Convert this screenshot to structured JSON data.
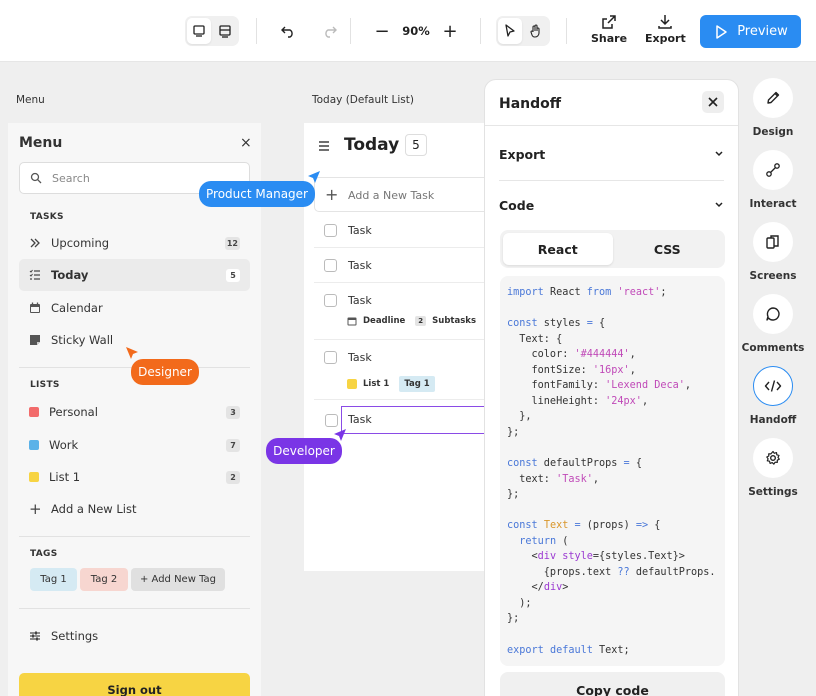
{
  "toolbar": {
    "zoom": "90%",
    "share_label": "Share",
    "export_label": "Export",
    "preview_label": "Preview"
  },
  "labels": {
    "menu_section": "Menu",
    "today_section": "Today (Default List)"
  },
  "menu": {
    "title": "Menu",
    "close": "×",
    "search_placeholder": "Search",
    "tasks_title": "TASKS",
    "tasks": [
      {
        "label": "Upcoming",
        "count": "12",
        "icon": "chevrons-right-icon"
      },
      {
        "label": "Today",
        "count": "5",
        "icon": "list-check-icon"
      },
      {
        "label": "Calendar",
        "icon": "calendar-icon"
      },
      {
        "label": "Sticky Wall",
        "icon": "sticky-note-icon"
      }
    ],
    "lists_title": "LISTS",
    "lists": [
      {
        "label": "Personal",
        "count": "3",
        "color": "#f26b6b"
      },
      {
        "label": "Work",
        "count": "7",
        "color": "#5bb2e8"
      },
      {
        "label": "List 1",
        "count": "2",
        "color": "#f7d443"
      }
    ],
    "add_list": "Add a New List",
    "tags_title": "TAGS",
    "tags": [
      {
        "label": "Tag 1",
        "color": "#d5eaf3"
      },
      {
        "label": "Tag 2",
        "color": "#f7d6d0"
      },
      {
        "label": "+ Add New Tag",
        "color": "#e4e4e4"
      }
    ],
    "settings": "Settings",
    "signout": "Sign out"
  },
  "today": {
    "title": "Today",
    "count": "5",
    "add_task": "Add a New Task",
    "tasks": [
      {
        "label": "Task"
      },
      {
        "label": "Task"
      },
      {
        "label": "Task",
        "deadline": "Deadline",
        "subtasks_count": "2",
        "subtasks_label": "Subtasks"
      },
      {
        "label": "Task",
        "list": "List 1",
        "tag": "Tag 1"
      },
      {
        "label": "Task"
      }
    ]
  },
  "handoff": {
    "title": "Handoff",
    "export_label": "Export",
    "code_label": "Code",
    "tabs": [
      "React",
      "CSS"
    ],
    "active_tab": "React",
    "copy_label": "Copy code",
    "code_lines": [
      "import React from 'react';",
      "",
      "const styles = {",
      "  Text: {",
      "    color: '#444444',",
      "    fontSize: '16px',",
      "    fontFamily: 'Lexend Deca',",
      "    lineHeight: '24px',",
      "  },",
      "};",
      "",
      "const defaultProps = {",
      "  text: 'Task',",
      "};",
      "",
      "const Text = (props) => {",
      "  return (",
      "    <div style={styles.Text}>",
      "      {props.text ?? defaultProps.",
      "    </div>",
      "  );",
      "};",
      "",
      "export default Text;"
    ]
  },
  "rail": [
    {
      "label": "Design",
      "icon": "pencil-icon"
    },
    {
      "label": "Interact",
      "icon": "interact-icon"
    },
    {
      "label": "Screens",
      "icon": "screens-icon"
    },
    {
      "label": "Comments",
      "icon": "comment-icon"
    },
    {
      "label": "Handoff",
      "icon": "code-icon",
      "active": true
    },
    {
      "label": "Settings",
      "icon": "gear-icon"
    }
  ],
  "cursors": [
    {
      "label": "Product Manager",
      "color": "#2a8cf2"
    },
    {
      "label": "Designer",
      "color": "#f26a1b"
    },
    {
      "label": "Developer",
      "color": "#7a35e6"
    }
  ]
}
